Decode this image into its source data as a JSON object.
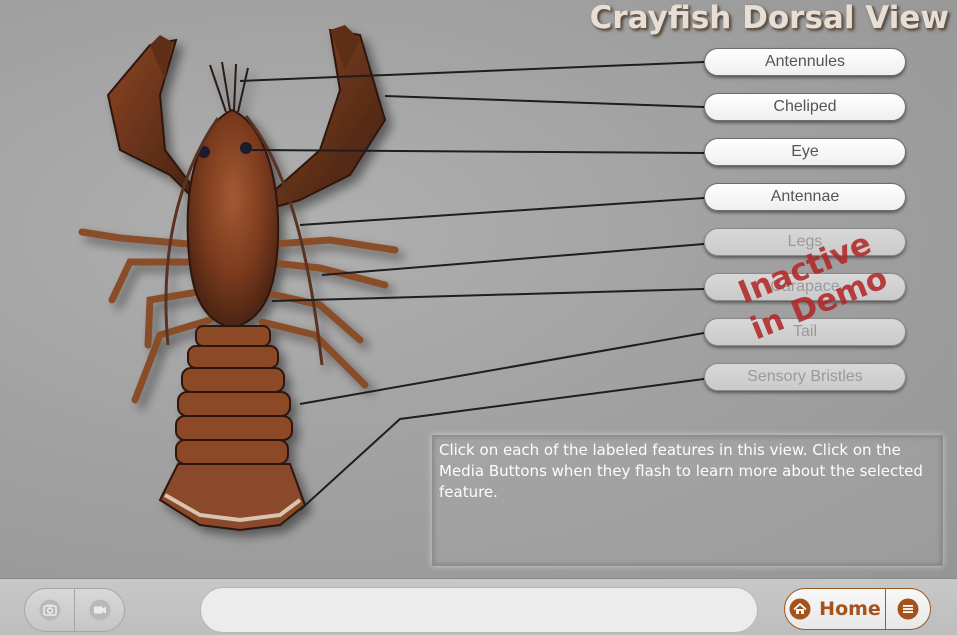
{
  "title": "Crayfish Dorsal View",
  "labels": [
    {
      "text": "Antennules",
      "active": true
    },
    {
      "text": "Cheliped",
      "active": true
    },
    {
      "text": "Eye",
      "active": true
    },
    {
      "text": "Antennae",
      "active": true
    },
    {
      "text": "Legs",
      "active": false
    },
    {
      "text": "Carapace",
      "active": false
    },
    {
      "text": "Tail",
      "active": false
    },
    {
      "text": "Sensory Bristles",
      "active": false
    }
  ],
  "demo_stamp": {
    "line1": "Inactive",
    "line2": "in Demo"
  },
  "instructions": "Click on each of the labeled features in this view. Click on the Media Buttons when they flash to learn more about the selected feature.",
  "toolbar": {
    "camera_icon": "camera-icon",
    "video_icon": "video-camera-icon",
    "status_text": "",
    "home_label": "Home",
    "home_icon": "home-icon",
    "menu_icon": "menu-icon"
  },
  "colors": {
    "accent": "#a3531b",
    "stamp": "#b02828",
    "background": "#a2a2a2"
  }
}
